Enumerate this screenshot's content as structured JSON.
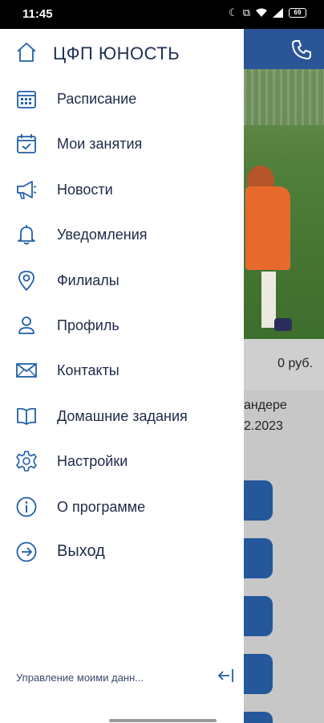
{
  "status_bar": {
    "time": "11:45",
    "battery": "69"
  },
  "drawer": {
    "title": "ЦФП ЮНОСТЬ",
    "items": [
      {
        "label": "Расписание",
        "icon": "calendar-grid-icon"
      },
      {
        "label": "Мои занятия",
        "icon": "calendar-check-icon"
      },
      {
        "label": "Новости",
        "icon": "megaphone-icon"
      },
      {
        "label": "Уведомления",
        "icon": "bell-icon"
      },
      {
        "label": "Филиалы",
        "icon": "map-pin-icon"
      },
      {
        "label": "Профиль",
        "icon": "person-icon"
      },
      {
        "label": "Контакты",
        "icon": "envelope-icon"
      },
      {
        "label": "Домашние задания",
        "icon": "book-icon"
      },
      {
        "label": "Настройки",
        "icon": "gear-icon"
      },
      {
        "label": "О программе",
        "icon": "info-icon"
      },
      {
        "label": "Выход",
        "icon": "exit-arrow-icon"
      }
    ],
    "footer_link": "Управление моими данн...",
    "accent": "#1f5fa8"
  },
  "background": {
    "price": "0 руб.",
    "card_line1": "андере",
    "card_line2": "2.2023",
    "header_color": "#2a5596",
    "button_color": "#25579b"
  }
}
